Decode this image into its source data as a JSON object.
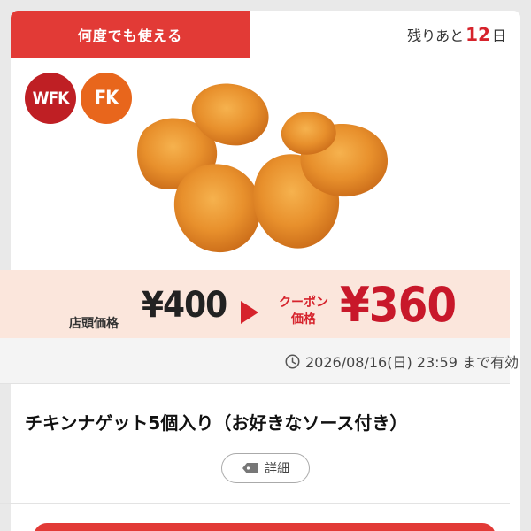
{
  "coupon": {
    "usage_tag": "何度でも使える",
    "days_left_prefix": "残りあと",
    "days_left_number": "12",
    "days_left_suffix": "日",
    "badges": [
      "WFK",
      "FK"
    ],
    "store_price_label": "店頭価格",
    "store_price": "¥400",
    "coupon_price_label": "クーポン価格",
    "coupon_price": "¥360",
    "expiry": "2026/08/16(日) 23:59 まで有効",
    "title": "チキンナゲット5個入り（お好きなソース付き）",
    "detail_label": "詳細"
  },
  "colors": {
    "accent_red": "#e23a36",
    "price_red": "#c8182a",
    "badge_wfk": "#bf1f24",
    "badge_fk": "#e8661c",
    "price_band": "#fbe6dc"
  },
  "icons": {
    "expiry": "clock-icon",
    "detail": "tag-icon",
    "arrow": "triangle-right-icon"
  }
}
